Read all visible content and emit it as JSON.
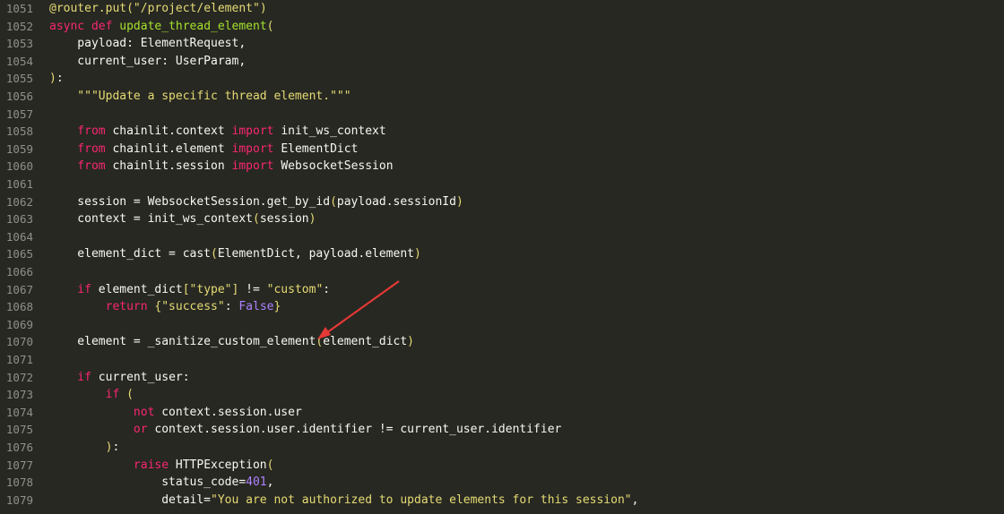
{
  "editor": {
    "accent": "#e53935",
    "lines": [
      {
        "n": "1051",
        "tokens": [
          [
            "dec",
            "@router.put("
          ],
          [
            "str",
            "\"/project/element\""
          ],
          [
            "dec",
            ")"
          ]
        ]
      },
      {
        "n": "1052",
        "tokens": [
          [
            "kw",
            "async def "
          ],
          [
            "fn",
            "update_thread_element"
          ],
          [
            "br",
            "("
          ]
        ]
      },
      {
        "n": "1053",
        "tokens": [
          [
            "p",
            "    payload: ElementRequest,"
          ]
        ]
      },
      {
        "n": "1054",
        "tokens": [
          [
            "p",
            "    current_user: UserParam,"
          ]
        ]
      },
      {
        "n": "1055",
        "tokens": [
          [
            "br",
            ")"
          ],
          [
            "p",
            ":"
          ]
        ]
      },
      {
        "n": "1056",
        "tokens": [
          [
            "str",
            "    \"\"\"Update a specific thread element.\"\"\""
          ]
        ]
      },
      {
        "n": "1057",
        "tokens": []
      },
      {
        "n": "1058",
        "tokens": [
          [
            "kw",
            "    from "
          ],
          [
            "p",
            "chainlit.context "
          ],
          [
            "kw",
            "import "
          ],
          [
            "p",
            "init_ws_context"
          ]
        ]
      },
      {
        "n": "1059",
        "tokens": [
          [
            "kw",
            "    from "
          ],
          [
            "p",
            "chainlit.element "
          ],
          [
            "kw",
            "import "
          ],
          [
            "p",
            "ElementDict"
          ]
        ]
      },
      {
        "n": "1060",
        "tokens": [
          [
            "kw",
            "    from "
          ],
          [
            "p",
            "chainlit.session "
          ],
          [
            "kw",
            "import "
          ],
          [
            "p",
            "WebsocketSession"
          ]
        ]
      },
      {
        "n": "1061",
        "tokens": []
      },
      {
        "n": "1062",
        "tokens": [
          [
            "p",
            "    session = WebsocketSession.get_by_id"
          ],
          [
            "br",
            "("
          ],
          [
            "p",
            "payload.sessionId"
          ],
          [
            "br",
            ")"
          ]
        ]
      },
      {
        "n": "1063",
        "tokens": [
          [
            "p",
            "    context = init_ws_context"
          ],
          [
            "br",
            "("
          ],
          [
            "p",
            "session"
          ],
          [
            "br",
            ")"
          ]
        ]
      },
      {
        "n": "1064",
        "tokens": []
      },
      {
        "n": "1065",
        "tokens": [
          [
            "p",
            "    element_dict = cast"
          ],
          [
            "br",
            "("
          ],
          [
            "p",
            "ElementDict, payload.element"
          ],
          [
            "br",
            ")"
          ]
        ]
      },
      {
        "n": "1066",
        "tokens": []
      },
      {
        "n": "1067",
        "tokens": [
          [
            "kw",
            "    if "
          ],
          [
            "p",
            "element_dict"
          ],
          [
            "br",
            "["
          ],
          [
            "str",
            "\"type\""
          ],
          [
            "br",
            "]"
          ],
          [
            "p",
            " != "
          ],
          [
            "str",
            "\"custom\""
          ],
          [
            "p",
            ":"
          ]
        ]
      },
      {
        "n": "1068",
        "tokens": [
          [
            "kw",
            "        return "
          ],
          [
            "br",
            "{"
          ],
          [
            "str",
            "\"success\""
          ],
          [
            "p",
            ": "
          ],
          [
            "const",
            "False"
          ],
          [
            "br",
            "}"
          ]
        ]
      },
      {
        "n": "1069",
        "tokens": []
      },
      {
        "n": "1070",
        "tokens": [
          [
            "p",
            "    element = _sanitize_custom_element"
          ],
          [
            "br",
            "("
          ],
          [
            "p",
            "element_dict"
          ],
          [
            "br",
            ")"
          ]
        ]
      },
      {
        "n": "1071",
        "tokens": []
      },
      {
        "n": "1072",
        "tokens": [
          [
            "kw",
            "    if "
          ],
          [
            "p",
            "current_user:"
          ]
        ]
      },
      {
        "n": "1073",
        "tokens": [
          [
            "kw",
            "        if "
          ],
          [
            "br",
            "("
          ]
        ]
      },
      {
        "n": "1074",
        "tokens": [
          [
            "kw",
            "            not "
          ],
          [
            "p",
            "context.session.user"
          ]
        ]
      },
      {
        "n": "1075",
        "tokens": [
          [
            "kw",
            "            or "
          ],
          [
            "p",
            "context.session.user.identifier != current_user.identifier"
          ]
        ]
      },
      {
        "n": "1076",
        "tokens": [
          [
            "br",
            "        )"
          ],
          [
            "p",
            ":"
          ]
        ]
      },
      {
        "n": "1077",
        "tokens": [
          [
            "kw",
            "            raise "
          ],
          [
            "p",
            "HTTPException"
          ],
          [
            "br",
            "("
          ]
        ]
      },
      {
        "n": "1078",
        "tokens": [
          [
            "p",
            "                status_code="
          ],
          [
            "num",
            "401"
          ],
          [
            "p",
            ","
          ]
        ]
      },
      {
        "n": "1079",
        "tokens": [
          [
            "p",
            "                detail="
          ],
          [
            "str",
            "\"You are not authorized to update elements for this session\""
          ],
          [
            "p",
            ","
          ]
        ]
      }
    ]
  }
}
